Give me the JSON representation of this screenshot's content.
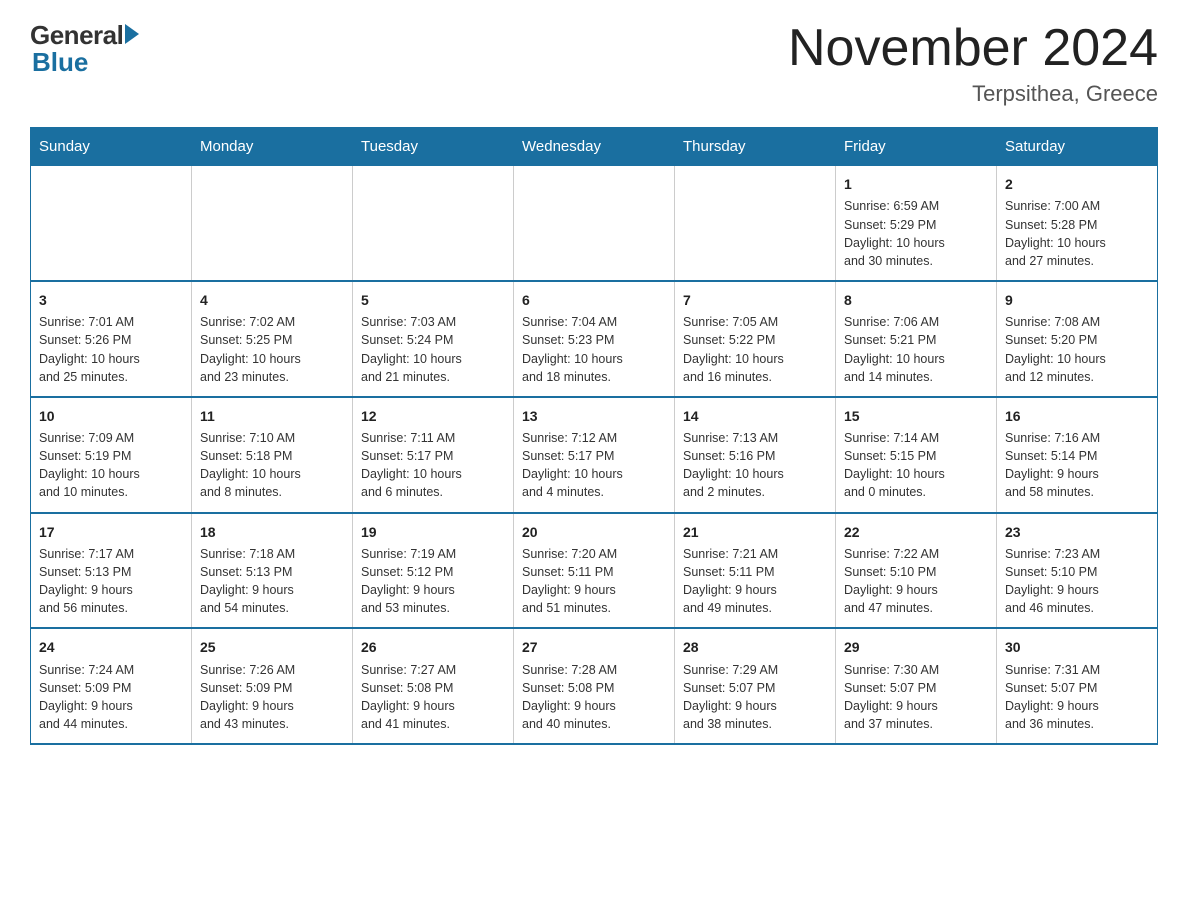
{
  "header": {
    "logo_general": "General",
    "logo_blue": "Blue",
    "main_title": "November 2024",
    "subtitle": "Terpsithea, Greece"
  },
  "weekdays": [
    "Sunday",
    "Monday",
    "Tuesday",
    "Wednesday",
    "Thursday",
    "Friday",
    "Saturday"
  ],
  "weeks": [
    [
      {
        "day": "",
        "info": ""
      },
      {
        "day": "",
        "info": ""
      },
      {
        "day": "",
        "info": ""
      },
      {
        "day": "",
        "info": ""
      },
      {
        "day": "",
        "info": ""
      },
      {
        "day": "1",
        "info": "Sunrise: 6:59 AM\nSunset: 5:29 PM\nDaylight: 10 hours\nand 30 minutes."
      },
      {
        "day": "2",
        "info": "Sunrise: 7:00 AM\nSunset: 5:28 PM\nDaylight: 10 hours\nand 27 minutes."
      }
    ],
    [
      {
        "day": "3",
        "info": "Sunrise: 7:01 AM\nSunset: 5:26 PM\nDaylight: 10 hours\nand 25 minutes."
      },
      {
        "day": "4",
        "info": "Sunrise: 7:02 AM\nSunset: 5:25 PM\nDaylight: 10 hours\nand 23 minutes."
      },
      {
        "day": "5",
        "info": "Sunrise: 7:03 AM\nSunset: 5:24 PM\nDaylight: 10 hours\nand 21 minutes."
      },
      {
        "day": "6",
        "info": "Sunrise: 7:04 AM\nSunset: 5:23 PM\nDaylight: 10 hours\nand 18 minutes."
      },
      {
        "day": "7",
        "info": "Sunrise: 7:05 AM\nSunset: 5:22 PM\nDaylight: 10 hours\nand 16 minutes."
      },
      {
        "day": "8",
        "info": "Sunrise: 7:06 AM\nSunset: 5:21 PM\nDaylight: 10 hours\nand 14 minutes."
      },
      {
        "day": "9",
        "info": "Sunrise: 7:08 AM\nSunset: 5:20 PM\nDaylight: 10 hours\nand 12 minutes."
      }
    ],
    [
      {
        "day": "10",
        "info": "Sunrise: 7:09 AM\nSunset: 5:19 PM\nDaylight: 10 hours\nand 10 minutes."
      },
      {
        "day": "11",
        "info": "Sunrise: 7:10 AM\nSunset: 5:18 PM\nDaylight: 10 hours\nand 8 minutes."
      },
      {
        "day": "12",
        "info": "Sunrise: 7:11 AM\nSunset: 5:17 PM\nDaylight: 10 hours\nand 6 minutes."
      },
      {
        "day": "13",
        "info": "Sunrise: 7:12 AM\nSunset: 5:17 PM\nDaylight: 10 hours\nand 4 minutes."
      },
      {
        "day": "14",
        "info": "Sunrise: 7:13 AM\nSunset: 5:16 PM\nDaylight: 10 hours\nand 2 minutes."
      },
      {
        "day": "15",
        "info": "Sunrise: 7:14 AM\nSunset: 5:15 PM\nDaylight: 10 hours\nand 0 minutes."
      },
      {
        "day": "16",
        "info": "Sunrise: 7:16 AM\nSunset: 5:14 PM\nDaylight: 9 hours\nand 58 minutes."
      }
    ],
    [
      {
        "day": "17",
        "info": "Sunrise: 7:17 AM\nSunset: 5:13 PM\nDaylight: 9 hours\nand 56 minutes."
      },
      {
        "day": "18",
        "info": "Sunrise: 7:18 AM\nSunset: 5:13 PM\nDaylight: 9 hours\nand 54 minutes."
      },
      {
        "day": "19",
        "info": "Sunrise: 7:19 AM\nSunset: 5:12 PM\nDaylight: 9 hours\nand 53 minutes."
      },
      {
        "day": "20",
        "info": "Sunrise: 7:20 AM\nSunset: 5:11 PM\nDaylight: 9 hours\nand 51 minutes."
      },
      {
        "day": "21",
        "info": "Sunrise: 7:21 AM\nSunset: 5:11 PM\nDaylight: 9 hours\nand 49 minutes."
      },
      {
        "day": "22",
        "info": "Sunrise: 7:22 AM\nSunset: 5:10 PM\nDaylight: 9 hours\nand 47 minutes."
      },
      {
        "day": "23",
        "info": "Sunrise: 7:23 AM\nSunset: 5:10 PM\nDaylight: 9 hours\nand 46 minutes."
      }
    ],
    [
      {
        "day": "24",
        "info": "Sunrise: 7:24 AM\nSunset: 5:09 PM\nDaylight: 9 hours\nand 44 minutes."
      },
      {
        "day": "25",
        "info": "Sunrise: 7:26 AM\nSunset: 5:09 PM\nDaylight: 9 hours\nand 43 minutes."
      },
      {
        "day": "26",
        "info": "Sunrise: 7:27 AM\nSunset: 5:08 PM\nDaylight: 9 hours\nand 41 minutes."
      },
      {
        "day": "27",
        "info": "Sunrise: 7:28 AM\nSunset: 5:08 PM\nDaylight: 9 hours\nand 40 minutes."
      },
      {
        "day": "28",
        "info": "Sunrise: 7:29 AM\nSunset: 5:07 PM\nDaylight: 9 hours\nand 38 minutes."
      },
      {
        "day": "29",
        "info": "Sunrise: 7:30 AM\nSunset: 5:07 PM\nDaylight: 9 hours\nand 37 minutes."
      },
      {
        "day": "30",
        "info": "Sunrise: 7:31 AM\nSunset: 5:07 PM\nDaylight: 9 hours\nand 36 minutes."
      }
    ]
  ]
}
